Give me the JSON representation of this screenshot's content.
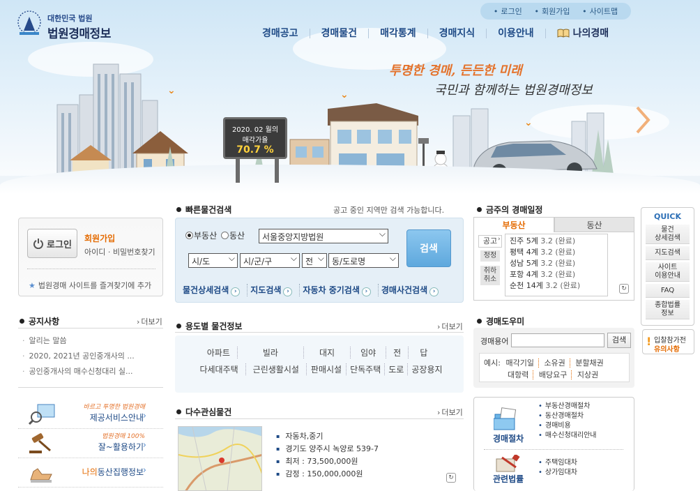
{
  "header": {
    "logo_small": "대한민국 법원",
    "logo_big": "법원경매정보",
    "top_links": [
      "로그인",
      "회원가입",
      "사이트맵"
    ],
    "nav": [
      "경매공고",
      "경매물건",
      "매각통계",
      "경매지식",
      "이용안내",
      "나의경매"
    ]
  },
  "hero": {
    "slogan_line1": "투명한 경매, 든든한 미래",
    "slogan_line2": "국민과 함께하는 법원경매정보",
    "rate_line1": "2020. 02 월의",
    "rate_line2": "매각가율",
    "rate_value": "70.7 %"
  },
  "login": {
    "button_label": "로그인",
    "join_label": "회원가입",
    "find_label": "아이디 · 비밀번호찾기",
    "favorite_label": "법원경매 사이트를 즐겨찾기에 추가"
  },
  "notice": {
    "title": "공지사항",
    "more": "더보기",
    "items": [
      "알리는 말씀",
      "2020, 2021년 공인중개사의 ...",
      "공인중개사의 매수신청대리 실..."
    ]
  },
  "promos": [
    {
      "sub": "바르고 투명한 법원경매",
      "main": "제공서비스안내"
    },
    {
      "sub": "법원경매 100%",
      "main": "잘~활용하기"
    },
    {
      "main_prefix": "나의",
      "main": "동산집행정보"
    }
  ],
  "quick_search": {
    "title": "빠른물건검색",
    "hint": "공고 중인 지역만 검색 가능합니다.",
    "radio_real_estate": "부동산",
    "radio_movable": "동산",
    "court_value": "서울중앙지방법원",
    "sido": "시/도",
    "sigungu": "시/군/구",
    "all": "전",
    "dong": "동/도로명",
    "search_button": "검색",
    "tabs": [
      "물건상세검색",
      "지도검색",
      "자동차 중기검색",
      "경매사건검색"
    ]
  },
  "usage": {
    "title": "용도별 물건정보",
    "more": "더보기",
    "row1": [
      "아파트",
      "빌라",
      "대지",
      "임야",
      "전",
      "답"
    ],
    "row2": [
      "다세대주택",
      "근린생활시설",
      "판매시설",
      "단독주택",
      "도로",
      "공장용지"
    ]
  },
  "popular": {
    "title": "다수관심물건",
    "more": "더보기",
    "items": [
      "자동차,중기",
      "경기도 양주시 녹양로 539-7",
      "최저 : 73,500,000원",
      "감정 : 150,000,000원"
    ]
  },
  "schedule": {
    "title": "금주의 경매일정",
    "tab_active": "부동산",
    "tab_other": "동산",
    "side_top": "공고",
    "side_mid": "정정",
    "side_low1": "취하",
    "side_low2": "취소",
    "items": [
      {
        "name": "진주 5계",
        "date": "3.2 (완료)"
      },
      {
        "name": "평택 4계",
        "date": "3.2 (완료)"
      },
      {
        "name": "성남 5계",
        "date": "3.2 (완료)"
      },
      {
        "name": "포항 4계",
        "date": "3.2 (완료)"
      },
      {
        "name": "순천 14계",
        "date": "3.2 (완료)"
      }
    ]
  },
  "helper": {
    "title": "경매도우미",
    "term_label": "경매용어",
    "search_button": "검색",
    "example_prefix": "예시:",
    "examples_row1": [
      "매각기일",
      "소유권",
      "분할채권"
    ],
    "examples_row2": [
      "대항력",
      "배당요구",
      "지상권"
    ]
  },
  "procedures": {
    "proc_label": "경매절차",
    "law_label": "관련법률",
    "proc_links": [
      "부동산경매절차",
      "동산경매절차",
      "경매비용",
      "매수신청대리안내"
    ],
    "law_links": [
      "주택임대차",
      "상가임대차"
    ]
  },
  "quick_menu": {
    "title": "QUICK",
    "items": [
      "물건\n상세검색",
      "지도검색",
      "사이트\n이용안내",
      "FAQ",
      "종합법률\n정보"
    ],
    "bidder_line1": "입찰참가전",
    "bidder_line2": "유의사항"
  },
  "colors": {
    "brand_navy": "#1e4a86",
    "accent_orange": "#e46a00",
    "search_blue": "#5ea8dd"
  }
}
